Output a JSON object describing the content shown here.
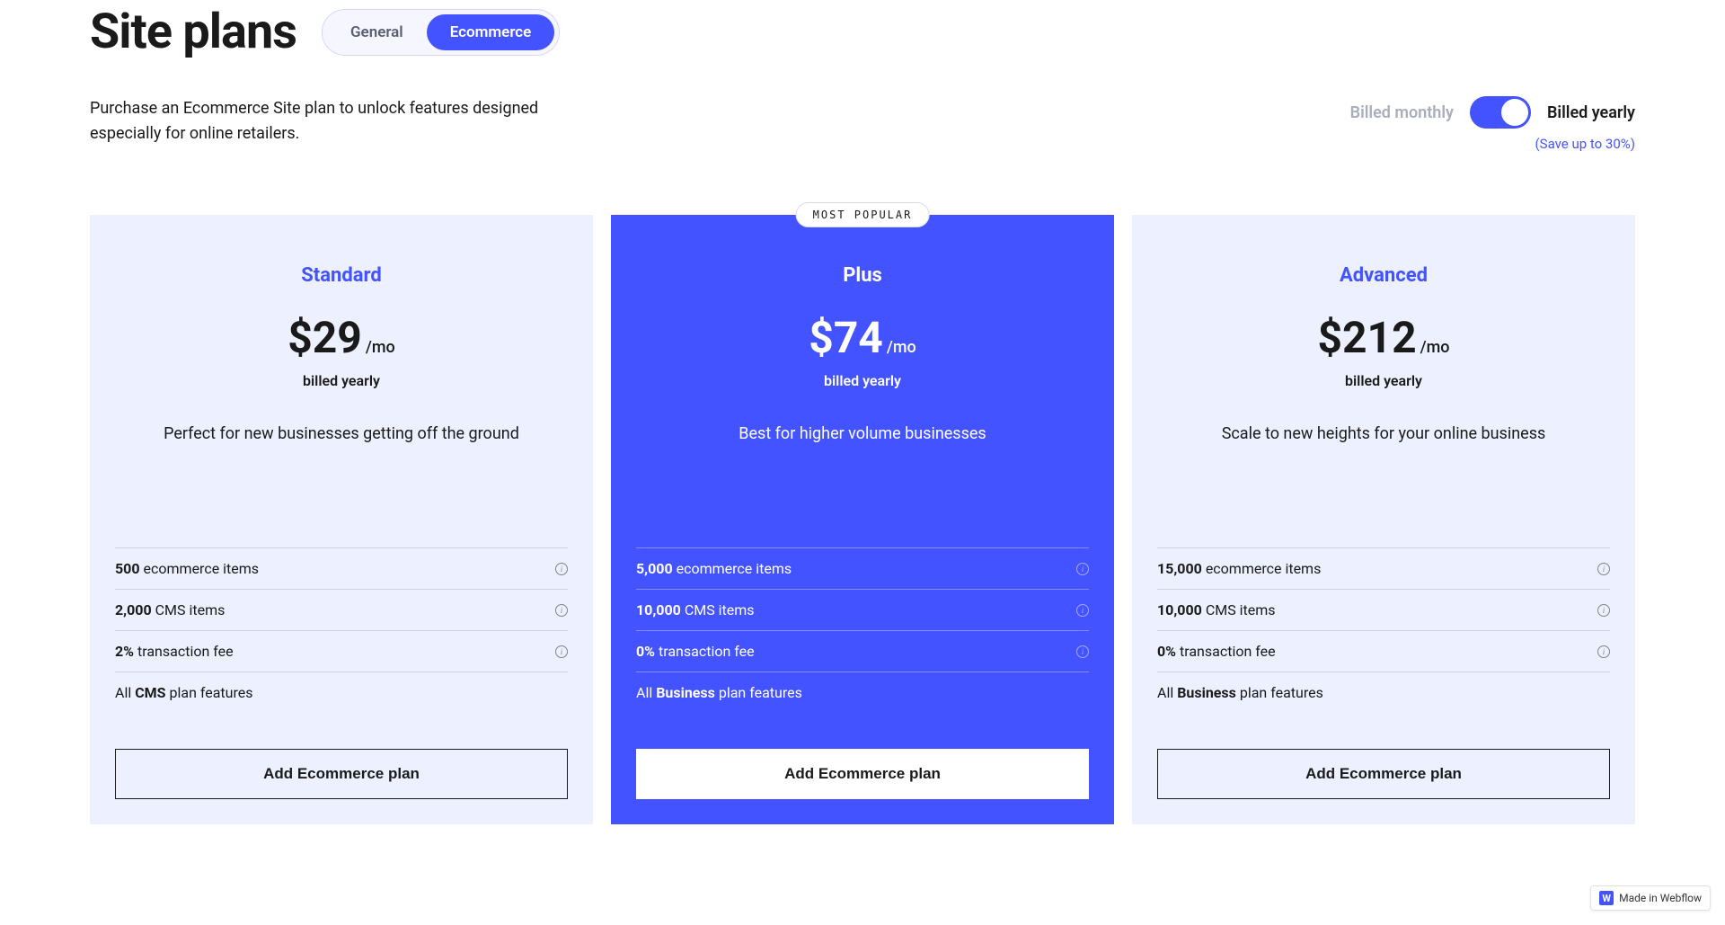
{
  "page": {
    "title": "Site plans",
    "description": "Purchase an Ecommerce Site plan to unlock features designed especially for online retailers."
  },
  "tabs": {
    "general": "General",
    "ecommerce": "Ecommerce"
  },
  "billing": {
    "monthly": "Billed monthly",
    "yearly": "Billed yearly",
    "save_note": "(Save up to 30%)"
  },
  "badges": {
    "most_popular": "MOST POPULAR"
  },
  "plans": [
    {
      "name": "Standard",
      "price": "$29",
      "per": "/mo",
      "billed": "billed yearly",
      "desc": "Perfect for new businesses getting off the ground",
      "features": [
        {
          "bold": "500",
          "rest": " ecommerce items",
          "info": true
        },
        {
          "bold": "2,000",
          "rest": " CMS items",
          "info": true
        },
        {
          "bold": "2%",
          "rest": " transaction fee",
          "info": true
        },
        {
          "pre": "All ",
          "bold": "CMS",
          "rest": " plan features",
          "info": false
        }
      ],
      "cta": "Add Ecommerce plan"
    },
    {
      "name": "Plus",
      "price": "$74",
      "per": "/mo",
      "billed": "billed yearly",
      "desc": "Best for higher volume businesses",
      "features": [
        {
          "bold": "5,000",
          "rest": " ecommerce items",
          "info": true
        },
        {
          "bold": "10,000",
          "rest": " CMS items",
          "info": true
        },
        {
          "bold": "0%",
          "rest": " transaction fee",
          "info": true
        },
        {
          "pre": "All ",
          "bold": "Business",
          "rest": " plan features",
          "info": false
        }
      ],
      "cta": "Add Ecommerce plan"
    },
    {
      "name": "Advanced",
      "price": "$212",
      "per": "/mo",
      "billed": "billed yearly",
      "desc": "Scale to new heights for your online business",
      "features": [
        {
          "bold": "15,000",
          "rest": " ecommerce items",
          "info": true
        },
        {
          "bold": "10,000",
          "rest": " CMS items",
          "info": true
        },
        {
          "bold": "0%",
          "rest": " transaction fee",
          "info": true
        },
        {
          "pre": "All ",
          "bold": "Business",
          "rest": " plan features",
          "info": false
        }
      ],
      "cta": "Add Ecommerce plan"
    }
  ],
  "webflow_badge": {
    "logo": "W",
    "text": "Made in Webflow"
  }
}
